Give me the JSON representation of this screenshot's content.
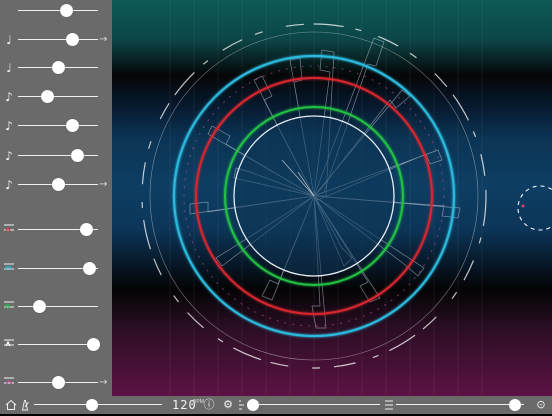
{
  "sidebar": {
    "rows": [
      {
        "icon": "",
        "value": 0.6,
        "arrow": "",
        "icon_name": "none"
      },
      {
        "icon": "♩",
        "value": 0.68,
        "arrow": "→",
        "icon_name": "quarter-note-icon"
      },
      {
        "icon": "♩",
        "value": 0.5,
        "arrow": "",
        "icon_name": "quarter-note-icon"
      },
      {
        "icon": "♪",
        "value": 0.36,
        "arrow": "",
        "icon_name": "eighth-note-icon"
      },
      {
        "icon": "♪",
        "value": 0.68,
        "arrow": "",
        "icon_name": "eighth-note-icon"
      },
      {
        "icon": "♪",
        "value": 0.74,
        "arrow": "",
        "icon_name": "eighth-note-icon"
      },
      {
        "icon": "♪",
        "value": 0.5,
        "arrow": "→",
        "icon_name": "eighth-note-icon"
      },
      {
        "icon": "",
        "value": 0.85,
        "arrow": "",
        "icon_name": "sound-red-icon"
      },
      {
        "icon": "",
        "value": 0.89,
        "arrow": "",
        "icon_name": "sound-teal-icon"
      },
      {
        "icon": "",
        "value": 0.26,
        "arrow": "",
        "icon_name": "sound-green-icon"
      },
      {
        "icon": "",
        "value": 0.94,
        "arrow": "",
        "icon_name": "sound-white-icon"
      },
      {
        "icon": "",
        "value": 0.5,
        "arrow": "→",
        "icon_name": "sound-pink-icon"
      }
    ]
  },
  "bottombar": {
    "tempo": "120",
    "tempo_unit": "BPM",
    "left_slider_value": 0.45,
    "right_slider_value": 0.93,
    "icons": {
      "home": "home-icon",
      "metronome": "metronome-icon",
      "info": "ⓘ",
      "settings": "⚙",
      "record": "⊙"
    }
  },
  "colors": {
    "sidebar_bg": "#6a6a6a",
    "teal": "#29b6d8",
    "red": "#d8262f",
    "green": "#21c143",
    "white": "#e8eef5",
    "pink": "#c84f9f"
  }
}
